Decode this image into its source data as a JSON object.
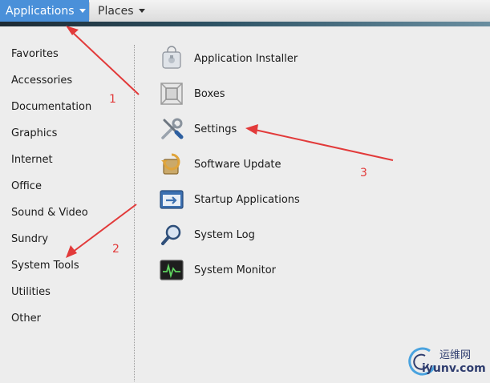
{
  "topbar": {
    "applications_label": "Applications",
    "places_label": "Places"
  },
  "categories": [
    {
      "label": "Favorites"
    },
    {
      "label": "Accessories"
    },
    {
      "label": "Documentation"
    },
    {
      "label": "Graphics"
    },
    {
      "label": "Internet"
    },
    {
      "label": "Office"
    },
    {
      "label": "Sound & Video"
    },
    {
      "label": "Sundry"
    },
    {
      "label": "System Tools"
    },
    {
      "label": "Utilities"
    },
    {
      "label": "Other"
    }
  ],
  "apps": [
    {
      "label": "Application Installer",
      "icon": "package-installer-icon"
    },
    {
      "label": "Boxes",
      "icon": "boxes-icon"
    },
    {
      "label": "Settings",
      "icon": "settings-tools-icon"
    },
    {
      "label": "Software Update",
      "icon": "software-update-icon"
    },
    {
      "label": "Startup Applications",
      "icon": "startup-applications-icon"
    },
    {
      "label": "System Log",
      "icon": "system-log-icon"
    },
    {
      "label": "System Monitor",
      "icon": "system-monitor-icon"
    }
  ],
  "annotations": {
    "n1": "1",
    "n2": "2",
    "n3": "3",
    "color": "#e23a3a"
  },
  "watermark": {
    "name": "运维网",
    "url": "iyunv.com"
  }
}
